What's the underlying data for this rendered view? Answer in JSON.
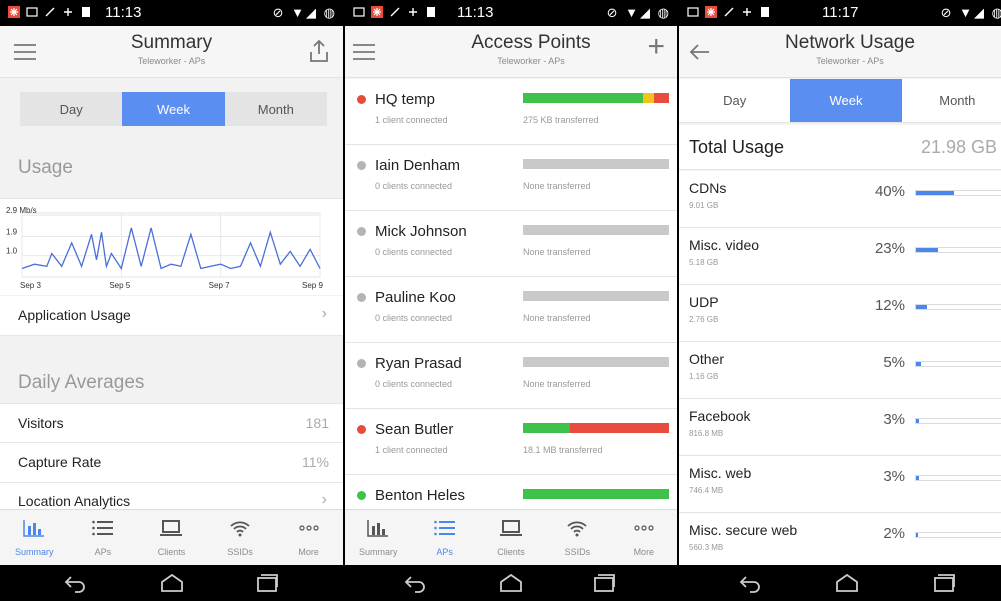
{
  "colors": {
    "accent": "#4b86ea",
    "red": "#e74c3c",
    "green": "#3ec24a",
    "gray": "#b4b4b4",
    "yellow": "#f0c419",
    "bar_empty": "#c9c9c9"
  },
  "status_bars": [
    {
      "time": "11:13",
      "right": "⊘ ▼◢ ◍"
    },
    {
      "time": "11:13",
      "right": "⊘ ▼◢ ◍"
    },
    {
      "time": "11:17",
      "right": "⊘ ▼◢ ◍"
    }
  ],
  "summary": {
    "title": "Summary",
    "subtitle": "Teleworker - APs",
    "segments": [
      "Day",
      "Week",
      "Month"
    ],
    "active_segment": "Week",
    "usage_heading": "Usage",
    "chart_data": {
      "type": "line",
      "y_tick_labels": [
        "2.9 Mb/s",
        "1.9",
        "1.0"
      ],
      "y_ticks": [
        2.9,
        1.9,
        1.0
      ],
      "ylim": [
        0,
        3.0
      ],
      "x_tick_labels": [
        "Sep 3",
        "Sep 5",
        "Sep 7",
        "Sep 9"
      ],
      "x": [
        3.0,
        3.25,
        3.5,
        3.6,
        3.8,
        4.0,
        4.2,
        4.4,
        4.5,
        4.6,
        4.7,
        4.8,
        5.0,
        5.2,
        5.4,
        5.6,
        5.8,
        6.0,
        6.2,
        6.4,
        6.6,
        6.8,
        7.0,
        7.2,
        7.4,
        7.6,
        7.8,
        8.0,
        8.2,
        8.4,
        8.6,
        8.8,
        9.0
      ],
      "y": [
        0.4,
        0.6,
        0.5,
        1.1,
        0.5,
        1.6,
        0.5,
        2.0,
        0.8,
        2.1,
        0.5,
        1.1,
        0.4,
        2.3,
        0.5,
        2.3,
        0.4,
        0.6,
        0.5,
        2.0,
        0.4,
        0.5,
        0.6,
        0.4,
        0.5,
        1.6,
        0.5,
        2.1,
        0.6,
        1.2,
        0.5,
        1.3,
        0.4
      ],
      "grid": true
    },
    "application_usage": "Application Usage",
    "daily_averages_heading": "Daily Averages",
    "rows": [
      {
        "label": "Visitors",
        "value": "181"
      },
      {
        "label": "Capture Rate",
        "value": "11%"
      },
      {
        "label": "Location Analytics",
        "value": ""
      }
    ],
    "chevron": "›"
  },
  "access_points": {
    "title": "Access Points",
    "subtitle": "Teleworker - APs",
    "add_label": "+",
    "items": [
      {
        "name": "HQ temp",
        "clients": "1 client connected",
        "transfer": "275 KB transferred",
        "status": "red",
        "segments": [
          {
            "color": "green",
            "share": 0.82
          },
          {
            "color": "yellow",
            "share": 0.08
          },
          {
            "color": "red",
            "share": 0.1
          }
        ]
      },
      {
        "name": "Iain Denham",
        "clients": "0 clients connected",
        "transfer": "None transferred",
        "status": "gray",
        "segments": []
      },
      {
        "name": "Mick Johnson",
        "clients": "0 clients connected",
        "transfer": "None transferred",
        "status": "gray",
        "segments": []
      },
      {
        "name": "Pauline Koo",
        "clients": "0 clients connected",
        "transfer": "None transferred",
        "status": "gray",
        "segments": []
      },
      {
        "name": "Ryan Prasad",
        "clients": "0 clients connected",
        "transfer": "None transferred",
        "status": "gray",
        "segments": []
      },
      {
        "name": "Sean Butler",
        "clients": "1 client connected",
        "transfer": "18.1 MB transferred",
        "status": "red",
        "segments": [
          {
            "color": "green",
            "share": 0.32
          },
          {
            "color": "red",
            "share": 0.68
          }
        ]
      },
      {
        "name": "Benton Heles",
        "clients": "",
        "transfer": "",
        "status": "green",
        "segments": [
          {
            "color": "green",
            "share": 1.0
          }
        ]
      }
    ]
  },
  "network_usage": {
    "title": "Network Usage",
    "subtitle": "Teleworker - APs",
    "segments": [
      "Day",
      "Week",
      "Month"
    ],
    "active_segment": "Week",
    "total_label": "Total Usage",
    "total_value": "21.98 GB",
    "items": [
      {
        "name": "CDNs",
        "size": "9.01 GB",
        "pct": "40%",
        "share": 0.4
      },
      {
        "name": "Misc. video",
        "size": "5.18 GB",
        "pct": "23%",
        "share": 0.23
      },
      {
        "name": "UDP",
        "size": "2.76 GB",
        "pct": "12%",
        "share": 0.12
      },
      {
        "name": "Other",
        "size": "1.16 GB",
        "pct": "5%",
        "share": 0.05
      },
      {
        "name": "Facebook",
        "size": "816.8 MB",
        "pct": "3%",
        "share": 0.03
      },
      {
        "name": "Misc. web",
        "size": "746.4 MB",
        "pct": "3%",
        "share": 0.03
      },
      {
        "name": "Misc. secure web",
        "size": "560.3 MB",
        "pct": "2%",
        "share": 0.02
      }
    ]
  },
  "tabs": [
    {
      "label": "Summary",
      "icon": "bar-chart-icon"
    },
    {
      "label": "APs",
      "icon": "list-icon"
    },
    {
      "label": "Clients",
      "icon": "laptop-icon"
    },
    {
      "label": "SSIDs",
      "icon": "wifi-icon"
    },
    {
      "label": "More",
      "icon": "more-icon"
    }
  ],
  "active_tabs": [
    "Summary",
    "APs"
  ]
}
